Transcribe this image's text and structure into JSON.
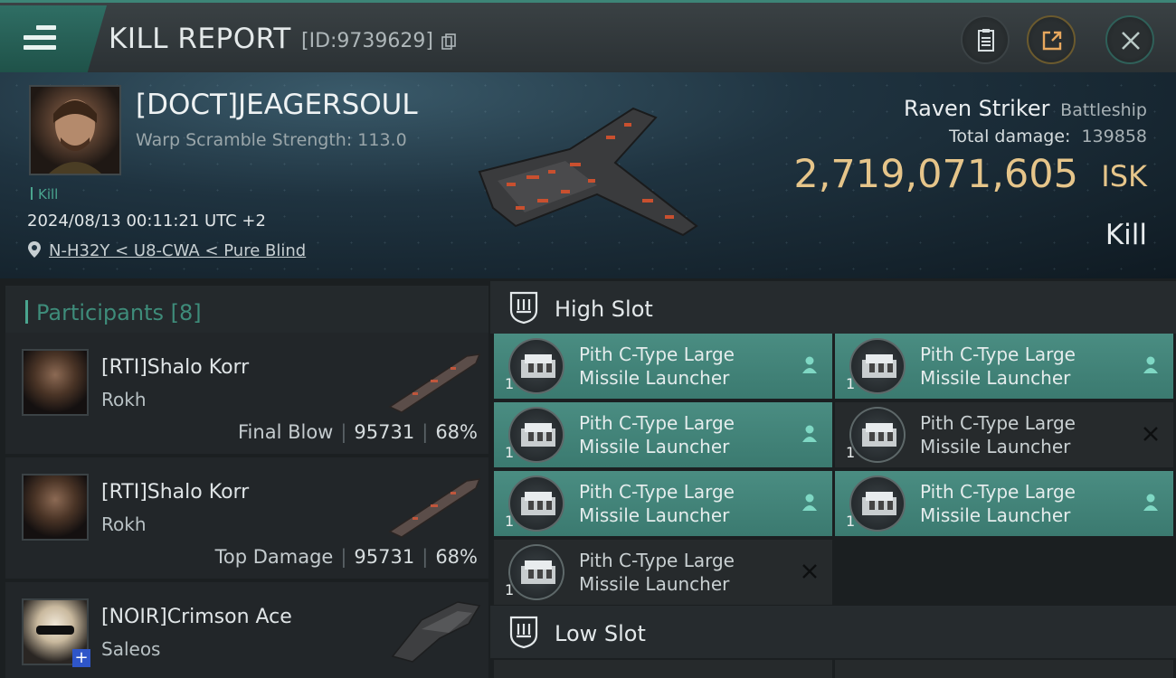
{
  "header": {
    "title": "KILL REPORT",
    "report_id": "[ID:9739629]",
    "icons": [
      "menu-icon",
      "copy-icon",
      "clipboard-icon",
      "share-icon",
      "close-icon"
    ]
  },
  "hero": {
    "pilot_name": "[DOCT]JEAGERSOUL",
    "warp_scramble": "Warp Scramble Strength: 113.0",
    "tag": "Kill",
    "datetime": "2024/08/13 00:11:21 UTC +2",
    "location": "N-H32Y < U8-CWA < Pure Blind",
    "ship_name": "Raven Striker",
    "ship_class": "Battleship",
    "total_damage_label": "Total damage:",
    "total_damage": "139858",
    "isk_value": "2,719,071,605",
    "isk_unit": "ISK",
    "result": "Kill"
  },
  "participants": {
    "header": "Participants [8]",
    "rows": [
      {
        "name": "[RTI]Shalo Korr",
        "ship": "Rokh",
        "label": "Final Blow",
        "damage": "95731",
        "percent": "68%"
      },
      {
        "name": "[RTI]Shalo Korr",
        "ship": "Rokh",
        "label": "Top Damage",
        "damage": "95731",
        "percent": "68%"
      },
      {
        "name": "[NOIR]Crimson Ace",
        "ship": "Saleos",
        "label": "",
        "damage": "",
        "percent": ""
      }
    ]
  },
  "fitting": {
    "high_slot_label": "High Slot",
    "low_slot_label": "Low Slot",
    "modules": [
      {
        "line1": "Pith C-Type Large",
        "line2": "Missile Launcher",
        "qty": "1",
        "status": "dropped"
      },
      {
        "line1": "Pith C-Type Large",
        "line2": "Missile Launcher",
        "qty": "1",
        "status": "dropped"
      },
      {
        "line1": "Pith C-Type Large",
        "line2": "Missile Launcher",
        "qty": "1",
        "status": "dropped"
      },
      {
        "line1": "Pith C-Type Large",
        "line2": "Missile Launcher",
        "qty": "1",
        "status": "destroyed"
      },
      {
        "line1": "Pith C-Type Large",
        "line2": "Missile Launcher",
        "qty": "1",
        "status": "dropped"
      },
      {
        "line1": "Pith C-Type Large",
        "line2": "Missile Launcher",
        "qty": "1",
        "status": "dropped"
      },
      {
        "line1": "Pith C-Type Large",
        "line2": "Missile Launcher",
        "qty": "1",
        "status": "destroyed"
      }
    ]
  },
  "colors": {
    "accent": "#3e8c7a",
    "isk": "#e6c58a",
    "module_dropped": "#4a8d82",
    "module_destroyed": "#262a2c"
  }
}
